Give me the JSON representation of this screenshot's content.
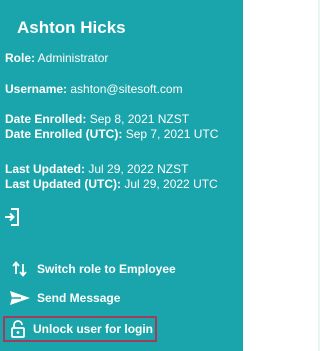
{
  "user": {
    "name": "Ashton Hicks",
    "role_label": "Role:",
    "role_value": "Administrator",
    "username_label": "Username:",
    "username_value": "ashton@sitesoft.com",
    "enrolled_label": "Date Enrolled:",
    "enrolled_value": "Sep 8, 2021 NZST",
    "enrolled_utc_label": "Date Enrolled (UTC):",
    "enrolled_utc_value": "Sep 7, 2021 UTC",
    "updated_label": "Last Updated:",
    "updated_value": "Jul 29, 2022 NZST",
    "updated_utc_label": "Last Updated (UTC):",
    "updated_utc_value": "Jul 29, 2022 UTC"
  },
  "actions": {
    "logout_icon": "logout-icon",
    "switch_role_label": "Switch role to Employee",
    "switch_role_icon": "swap-vertical-icon",
    "send_message_label": "Send Message",
    "send_message_icon": "send-icon",
    "unlock_label": "Unlock user for login",
    "unlock_icon": "lock-open-icon"
  },
  "colors": {
    "card_background": "#19a5ab",
    "text": "#ffffff",
    "highlight_border": "#a23c5b"
  }
}
